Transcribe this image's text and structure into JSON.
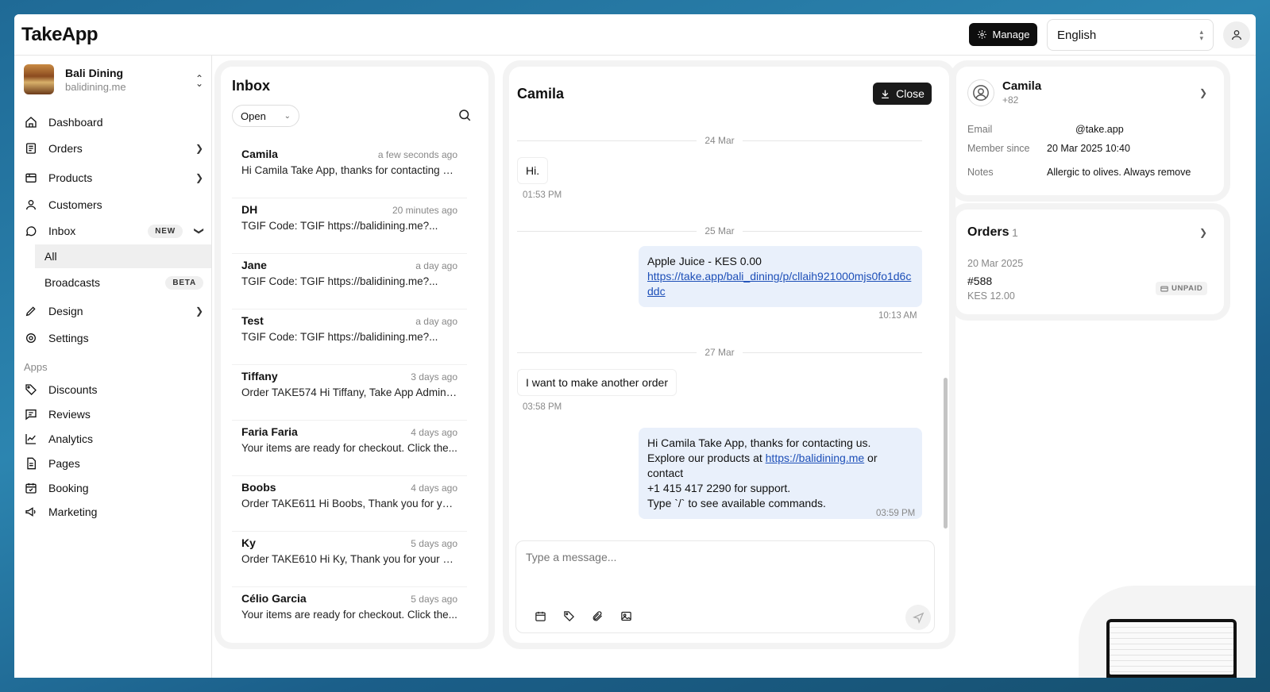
{
  "app": {
    "logo": "TakeApp",
    "manage_label": "Manage",
    "language": "English"
  },
  "store": {
    "name": "Bali Dining",
    "url": "balidining.me"
  },
  "nav": {
    "dashboard": "Dashboard",
    "orders": "Orders",
    "products": "Products",
    "customers": "Customers",
    "inbox": "Inbox",
    "inbox_badge": "NEW",
    "inbox_all": "All",
    "broadcasts": "Broadcasts",
    "broadcasts_badge": "BETA",
    "design": "Design",
    "settings": "Settings",
    "apps_label": "Apps",
    "discounts": "Discounts",
    "reviews": "Reviews",
    "analytics": "Analytics",
    "pages": "Pages",
    "booking": "Booking",
    "marketing": "Marketing"
  },
  "inbox": {
    "title": "Inbox",
    "status_filter": "Open",
    "conversations": [
      {
        "name": "Camila",
        "time": "a few seconds ago",
        "preview": "Hi Camila Take App, thanks for contacting us..."
      },
      {
        "name": "DH",
        "time": "20 minutes ago",
        "preview": "TGIF Code: TGIF https://balidining.me?..."
      },
      {
        "name": "Jane",
        "time": "a day ago",
        "preview": "TGIF Code: TGIF https://balidining.me?..."
      },
      {
        "name": "Test",
        "time": "a day ago",
        "preview": "TGIF Code: TGIF https://balidining.me?..."
      },
      {
        "name": "Tiffany",
        "time": "3 days ago",
        "preview": "Order TAKE574 Hi Tiffany, Take App Admin,..."
      },
      {
        "name": "Faria Faria",
        "time": "4 days ago",
        "preview": "Your items are ready for checkout. Click the..."
      },
      {
        "name": "Boobs",
        "time": "4 days ago",
        "preview": "Order TAKE611 Hi Boobs, Thank you for your..."
      },
      {
        "name": "Ky",
        "time": "5 days ago",
        "preview": "Order TAKE610 Hi Ky, Thank you for your ord..."
      },
      {
        "name": "Célio Garcia",
        "time": "5 days ago",
        "preview": "Your items are ready for checkout. Click the..."
      }
    ]
  },
  "chat": {
    "title": "Camila",
    "close_label": "Close",
    "date1": "24 Mar",
    "msg1_text": "Hi.",
    "msg1_time": "01:53 PM",
    "date2": "25 Mar",
    "msg2_text": "Apple Juice - KES 0.00",
    "msg2_link": "https://take.app/bali_dining/p/cllaih921000mjs0fo1d6cddc",
    "msg2_time": "10:13 AM",
    "date3": "27 Mar",
    "msg3_text": "I want to make another order",
    "msg3_time": "03:58 PM",
    "msg4_line1": "Hi Camila Take App, thanks for contacting us.",
    "msg4_line2_pre": "Explore our products at ",
    "msg4_link": "https://balidining.me",
    "msg4_line2_post": " or contact",
    "msg4_line3": "+1 415 417 2290 for support.",
    "msg4_line4": "Type `/` to see available commands.",
    "msg4_time": "03:59 PM",
    "composer_placeholder": "Type a message..."
  },
  "contact": {
    "name": "Camila",
    "phone": "+82",
    "email_label": "Email",
    "email_value": "@take.app",
    "member_label": "Member since",
    "member_value": "20 Mar 2025 10:40",
    "notes_label": "Notes",
    "notes_value": "Allergic to olives. Always remove"
  },
  "orders": {
    "title": "Orders",
    "count": "1",
    "date": "20 Mar 2025",
    "number": "#588",
    "total": "KES 12.00",
    "status": "UNPAID"
  }
}
